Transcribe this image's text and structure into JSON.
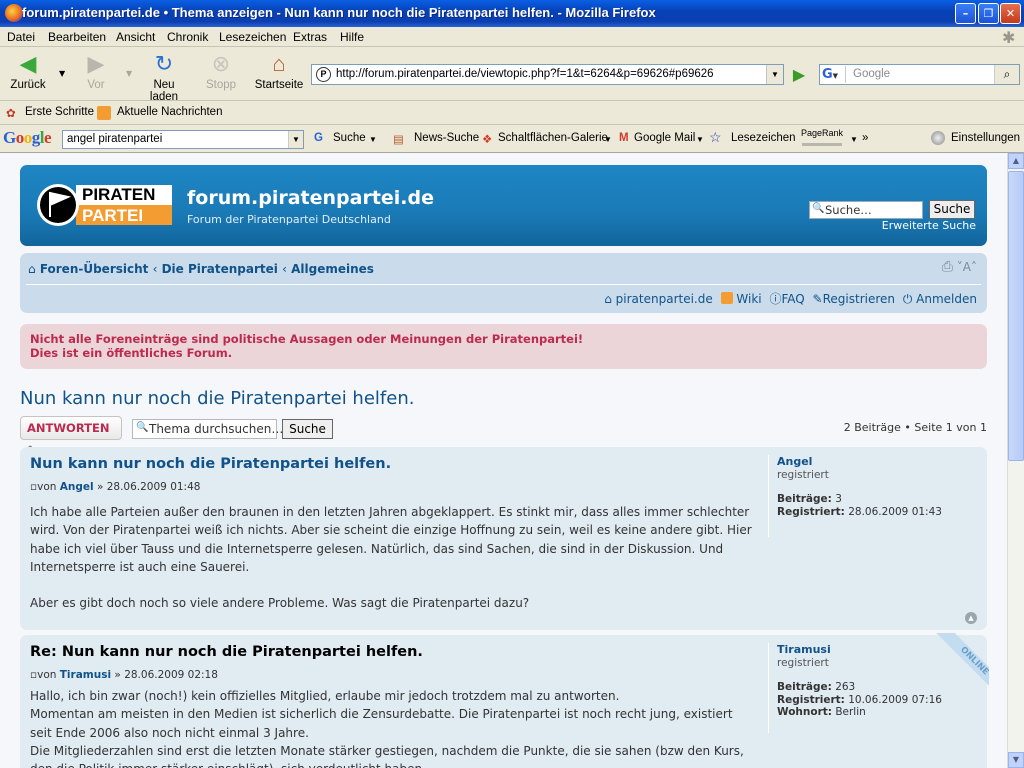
{
  "window": {
    "title": "forum.piratenpartei.de • Thema anzeigen - Nun kann nur noch die Piratenpartei helfen. - Mozilla Firefox"
  },
  "menu": [
    "Datei",
    "Bearbeiten",
    "Ansicht",
    "Chronik",
    "Lesezeichen",
    "Extras",
    "Hilfe"
  ],
  "nav": {
    "back": "Zurück",
    "forward": "Vor",
    "reload": "Neu laden",
    "stop": "Stopp",
    "home": "Startseite"
  },
  "url": "http://forum.piratenpartei.de/viewtopic.php?f=1&t=6264&p=69626#p69626",
  "search_placeholder": "Google",
  "bookmarks": {
    "first": "Erste Schritte",
    "news": "Aktuelle Nachrichten"
  },
  "gtoolbar": {
    "logo": "Google",
    "query": "angel piratenpartei",
    "search": "Suche",
    "news": "News-Suche",
    "gallery": "Schaltflächen-Galerie",
    "mail": "Google Mail",
    "bookmarks": "Lesezeichen",
    "pagerank": "PageRank",
    "more": "»",
    "settings": "Einstellungen"
  },
  "site": {
    "logo_top": "PIRATEN",
    "logo_bottom": "PARTEI",
    "title": "forum.piratenpartei.de",
    "desc": "Forum der Piratenpartei Deutschland",
    "search_placeholder": "Suche…",
    "search_btn": "Suche",
    "adv": "Erweiterte Suche"
  },
  "breadcrumb": {
    "home": "Foren-Übersicht",
    "sep": "‹",
    "c1": "Die Piratenpartei",
    "c2": "Allgemeines",
    "sizer": "A"
  },
  "links": {
    "home": "piratenpartei.de",
    "wiki": "Wiki",
    "faq": "FAQ",
    "register": "Registrieren",
    "login": "Anmelden"
  },
  "notice": {
    "line1": "Nicht alle Foreneinträge sind politische Aussagen oder Meinungen der Piratenpartei!",
    "line2": "Dies ist ein öffentliches Forum."
  },
  "topic": {
    "title": "Nun kann nur noch die Piratenpartei helfen.",
    "reply": "ANTWORTEN",
    "search_placeholder": "Thema durchsuchen…",
    "search_btn": "Suche",
    "pagination": "2 Beiträge • Seite 1 von 1"
  },
  "labels": {
    "by": "von",
    "arrow": "»",
    "posts": "Beiträge:",
    "registered": "Registriert:",
    "location": "Wohnort:",
    "online": "ONLINE"
  },
  "posts": [
    {
      "title": "Nun kann nur noch die Piratenpartei helfen.",
      "author": "Angel",
      "date": "28.06.2009 01:48",
      "body": [
        "Ich habe alle Parteien außer den braunen in den letzten Jahren abgeklappert. Es stinkt mir, dass alles immer schlechter wird. Von der Piratenpartei weiß ich nichts. Aber sie scheint die einzige Hoffnung zu sein, weil es keine andere gibt. Hier habe ich viel über Tauss und die Internetsperre gelesen. Natürlich, das sind Sachen, die sind in der Diskussion. Und Internetsperre ist auch eine Sauerei.",
        "Aber es gibt doch noch so viele andere Probleme. Was sagt die Piratenpartei dazu?"
      ],
      "profile": {
        "name": "Angel",
        "rank": "registriert",
        "posts": "3",
        "registered": "28.06.2009 01:43"
      }
    },
    {
      "title": "Re: Nun kann nur noch die Piratenpartei helfen.",
      "author": "Tiramusi",
      "date": "28.06.2009 02:18",
      "body": [
        "Hallo, ich bin zwar (noch!) kein offizielles Mitglied, erlaube mir jedoch trotzdem mal zu antworten.",
        "Momentan am meisten in den Medien ist sicherlich die Zensurdebatte. Die Piratenpartei ist noch recht jung, existiert seit Ende 2006 also noch nicht einmal 3 Jahre.",
        "Die Mitgliederzahlen sind erst die letzten Monate stärker gestiegen, nachdem die Punkte, die sie sahen (bzw den Kurs, den die Politik immer stärker einschlägt), sich verdeutlicht haben."
      ],
      "profile": {
        "name": "Tiramusi",
        "rank": "registriert",
        "posts": "263",
        "registered": "10.06.2009 07:16",
        "location": "Berlin"
      }
    }
  ]
}
